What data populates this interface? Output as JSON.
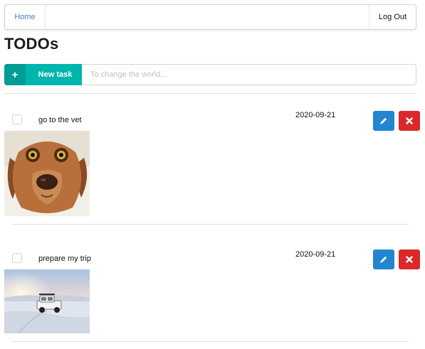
{
  "nav": {
    "home_label": "Home",
    "logout_label": "Log Out"
  },
  "page": {
    "title": "TODOs"
  },
  "new_task": {
    "button_icon": "plus-icon",
    "button_label": "New task",
    "input_placeholder": "To change the world...",
    "input_value": ""
  },
  "todos": [
    {
      "text": "go to the vet",
      "date": "2020-09-21",
      "completed": false,
      "image": "dog-photo",
      "edit_icon": "pencil-icon",
      "delete_icon": "close-icon"
    },
    {
      "text": "prepare my trip",
      "date": "2020-09-21",
      "completed": false,
      "image": "snowy-landscape-car-photo",
      "edit_icon": "pencil-icon",
      "delete_icon": "close-icon"
    }
  ],
  "colors": {
    "teal": "#00b5ad",
    "blue": "#2185d0",
    "red": "#db2828",
    "link": "#4183c4"
  }
}
